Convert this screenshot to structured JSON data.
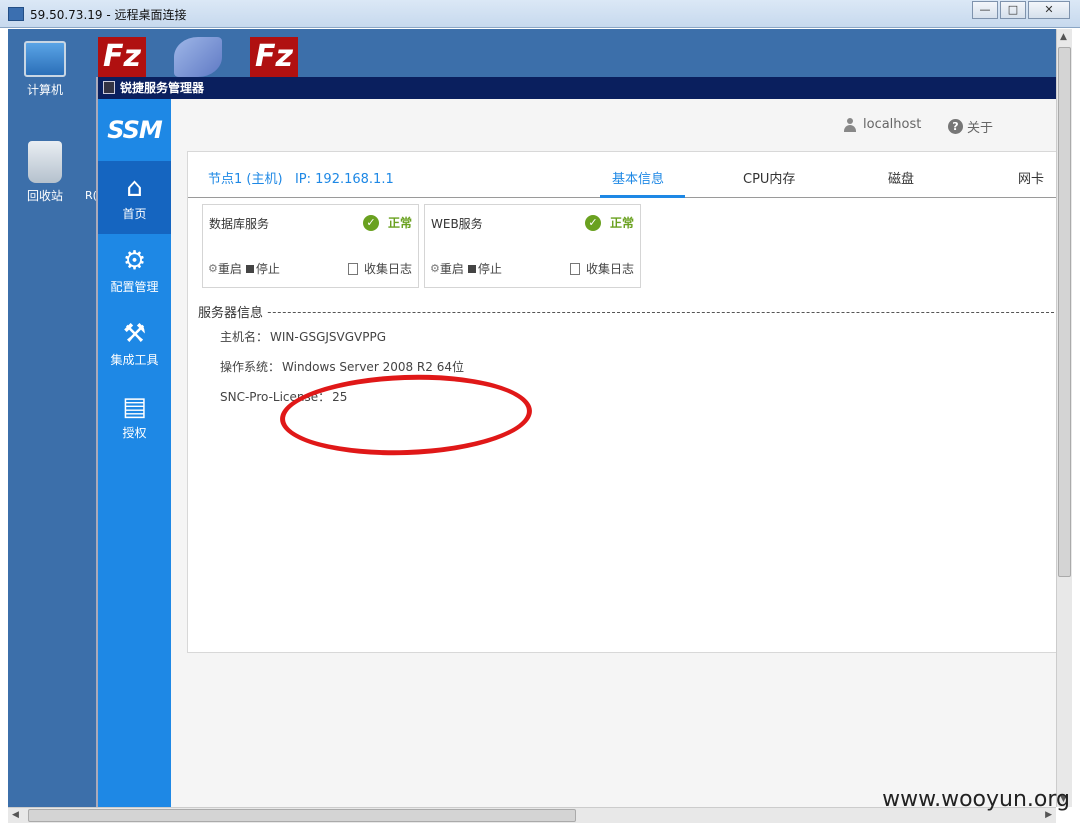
{
  "rdp": {
    "title": "59.50.73.19 - 远程桌面连接",
    "min": "—",
    "max": "□",
    "close": "✕"
  },
  "desktop": {
    "icons": [
      {
        "label": "计算机",
        "icon": "computer-icon"
      },
      {
        "label": "回收站",
        "icon": "recycle-bin-icon"
      }
    ],
    "taskbar_icons": [
      "filezilla-icon",
      "dolphin-icon",
      "filezilla-icon"
    ],
    "fz_glyph": "Fz",
    "partial_label": "R("
  },
  "ssm": {
    "title": "锐捷服务管理器",
    "logo": "SSM",
    "nav": [
      {
        "label": "首页",
        "icon": "home-icon",
        "glyph": "⌂",
        "active": true
      },
      {
        "label": "配置管理",
        "icon": "gear-icon",
        "glyph": "⚙"
      },
      {
        "label": "集成工具",
        "icon": "tools-icon",
        "glyph": "⚒"
      },
      {
        "label": "授权",
        "icon": "license-icon",
        "glyph": "▤"
      }
    ],
    "topbar": {
      "user": "localhost",
      "about": "关于",
      "help_glyph": "?"
    },
    "node": {
      "label": "节点1 (主机)",
      "ip": "IP: 192.168.1.1"
    },
    "tabs": [
      "基本信息",
      "CPU内存",
      "磁盘",
      "网卡"
    ],
    "services": [
      {
        "name": "数据库服务",
        "status": "正常",
        "restart": "重启",
        "stop": "停止",
        "log": "收集日志"
      },
      {
        "name": "WEB服务",
        "status": "正常",
        "restart": "重启",
        "stop": "停止",
        "log": "收集日志"
      }
    ],
    "server_info": {
      "title": "服务器信息",
      "rows": [
        {
          "key": "主机名：",
          "value": "WIN-GSGJSVGVPPG"
        },
        {
          "key": "操作系统：",
          "value": "Windows Server 2008 R2 64位"
        },
        {
          "key": "SNC-Pro-License：",
          "value": "25"
        }
      ]
    },
    "colors": {
      "sidebar": "#1e88e5",
      "active_nav": "#1565c0",
      "status_ok": "#6aa120",
      "title_bar": "#0a1f5e",
      "annotation": "#e01818"
    }
  },
  "watermark": "www.wooyun.org"
}
